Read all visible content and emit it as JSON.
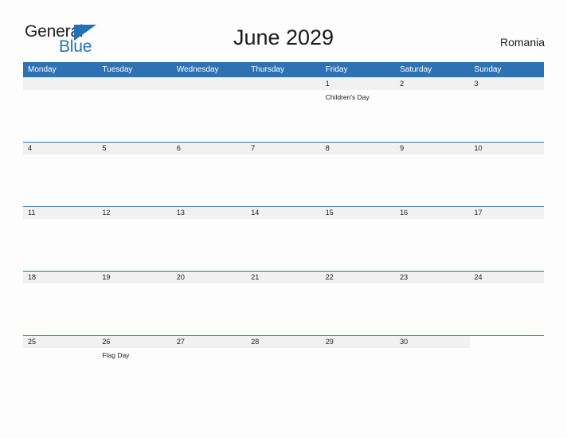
{
  "brand": {
    "name_part1": "General",
    "name_part2": "Blue",
    "flag_icon": "blue-triangle-flag"
  },
  "header": {
    "title": "June 2029",
    "country": "Romania"
  },
  "colors": {
    "header_blue": "#2e72b4",
    "band_gray": "#f1f1f1",
    "brand_blue": "#2272b8",
    "page_background": "#fdfdfd",
    "text": "#1a1a1a"
  },
  "calendar": {
    "weekdays": [
      "Monday",
      "Tuesday",
      "Wednesday",
      "Thursday",
      "Friday",
      "Saturday",
      "Sunday"
    ],
    "weeks": [
      [
        {
          "date": "",
          "event": ""
        },
        {
          "date": "",
          "event": ""
        },
        {
          "date": "",
          "event": ""
        },
        {
          "date": "",
          "event": ""
        },
        {
          "date": "1",
          "event": "Children's Day"
        },
        {
          "date": "2",
          "event": ""
        },
        {
          "date": "3",
          "event": ""
        }
      ],
      [
        {
          "date": "4",
          "event": ""
        },
        {
          "date": "5",
          "event": ""
        },
        {
          "date": "6",
          "event": ""
        },
        {
          "date": "7",
          "event": ""
        },
        {
          "date": "8",
          "event": ""
        },
        {
          "date": "9",
          "event": ""
        },
        {
          "date": "10",
          "event": ""
        }
      ],
      [
        {
          "date": "11",
          "event": ""
        },
        {
          "date": "12",
          "event": ""
        },
        {
          "date": "13",
          "event": ""
        },
        {
          "date": "14",
          "event": ""
        },
        {
          "date": "15",
          "event": ""
        },
        {
          "date": "16",
          "event": ""
        },
        {
          "date": "17",
          "event": ""
        }
      ],
      [
        {
          "date": "18",
          "event": ""
        },
        {
          "date": "19",
          "event": ""
        },
        {
          "date": "20",
          "event": ""
        },
        {
          "date": "21",
          "event": ""
        },
        {
          "date": "22",
          "event": ""
        },
        {
          "date": "23",
          "event": ""
        },
        {
          "date": "24",
          "event": ""
        }
      ],
      [
        {
          "date": "25",
          "event": ""
        },
        {
          "date": "26",
          "event": "Flag Day"
        },
        {
          "date": "27",
          "event": ""
        },
        {
          "date": "28",
          "event": ""
        },
        {
          "date": "29",
          "event": ""
        },
        {
          "date": "30",
          "event": ""
        },
        {
          "date": "",
          "event": ""
        }
      ]
    ]
  }
}
